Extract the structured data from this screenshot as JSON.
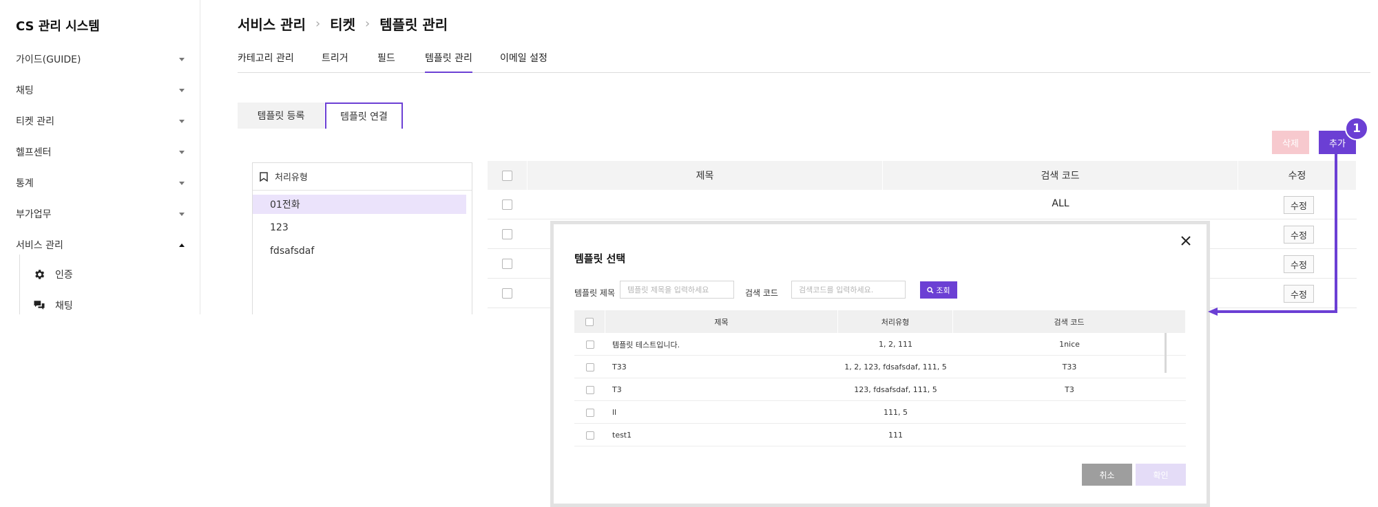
{
  "app": {
    "title": "CS 관리 시스템"
  },
  "sidebar": {
    "items": [
      {
        "label": "가이드(GUIDE)"
      },
      {
        "label": "채팅"
      },
      {
        "label": "티켓 관리"
      },
      {
        "label": "헬프센터"
      },
      {
        "label": "통계"
      },
      {
        "label": "부가업무"
      },
      {
        "label": "서비스 관리"
      }
    ],
    "subitems": [
      {
        "label": "인증",
        "icon": "gear-icon"
      },
      {
        "label": "채팅",
        "icon": "chat-bubbles-icon"
      }
    ]
  },
  "breadcrumb": {
    "level1": "서비스 관리",
    "level2": "티켓",
    "level3": "템플릿 관리"
  },
  "tabs": [
    "카테고리 관리",
    "트리거",
    "필드",
    "템플릿 관리",
    "이메일 설정"
  ],
  "subtabs": {
    "register": "템플릿 등록",
    "link": "템플릿 연결"
  },
  "actions": {
    "delete": "삭제",
    "add": "추가",
    "step": "1"
  },
  "type_panel": {
    "header": "처리유형",
    "items": [
      "01전화",
      "123",
      "fdsafsdaf"
    ]
  },
  "main_table": {
    "headers": {
      "title": "제목",
      "code": "검색 코드",
      "edit": "수정"
    },
    "rows": [
      {
        "title": "",
        "code": "ALL",
        "edit": "수정"
      },
      {
        "title": "",
        "code": "",
        "edit": "수정"
      },
      {
        "title": "",
        "code": "",
        "edit": "수정"
      },
      {
        "title": "",
        "code": "",
        "edit": "수정"
      }
    ]
  },
  "modal": {
    "title": "템플릿 선택",
    "title_label": "템플릿 제목",
    "title_placeholder": "템플릿 제목을 입력하세요",
    "code_label": "검색 코드",
    "code_placeholder": "검색코드를 입력하세요.",
    "search_button": "조회",
    "headers": {
      "title": "제목",
      "type": "처리유형",
      "code": "검색 코드"
    },
    "rows": [
      {
        "title": "템플릿 테스트입니다.",
        "type": "1, 2, 111",
        "code": "1nice"
      },
      {
        "title": "T33",
        "type": "1, 2, 123, fdsafsdaf, 111, 5",
        "code": "T33"
      },
      {
        "title": "T3",
        "type": "123, fdsafsdaf, 111, 5",
        "code": "T3"
      },
      {
        "title": "ll",
        "type": "111, 5",
        "code": ""
      },
      {
        "title": "test1",
        "type": "111",
        "code": ""
      }
    ],
    "cancel": "취소",
    "confirm": "확인"
  },
  "colors": {
    "accent": "#6b3fd4",
    "selected_row": "#ebe3fb",
    "delete_disabled": "#f7c9ce"
  }
}
